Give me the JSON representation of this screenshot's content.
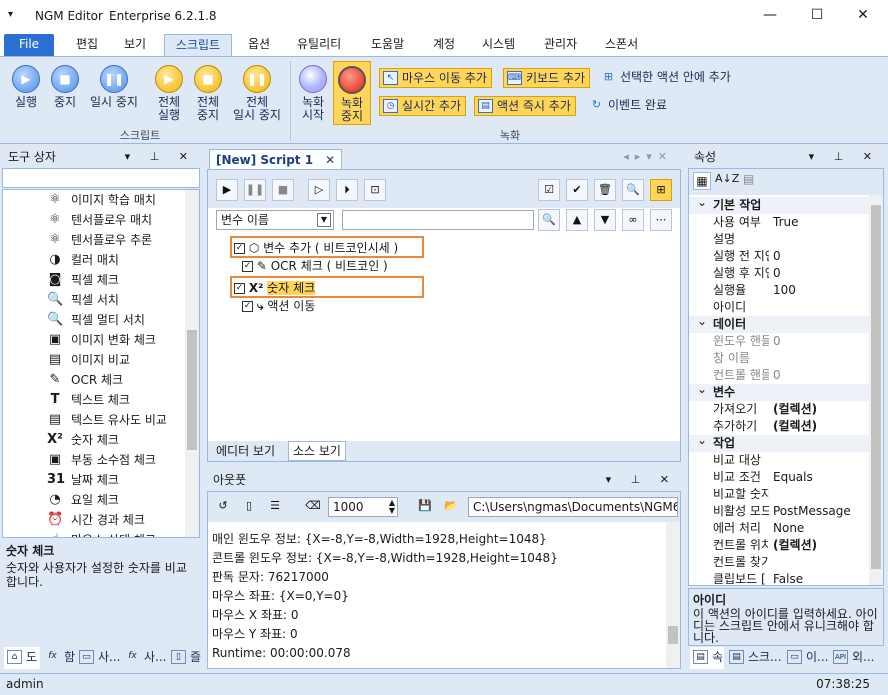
{
  "titlebar": {
    "app": "NGM Editor",
    "edition": "Enterprise 6.2.1.8",
    "menu_icon": "chevron-down-icon",
    "min": "—",
    "max": "☐",
    "close": "✕"
  },
  "menu": [
    "File",
    "편집",
    "보기",
    "스크립트",
    "옵션",
    "유틸리티",
    "도움말",
    "계정",
    "시스템",
    "관리자",
    "스폰서"
  ],
  "ribbon": {
    "script_buttons": [
      {
        "label": "실행",
        "glyph": "▶"
      },
      {
        "label": "중지",
        "glyph": "■"
      },
      {
        "label": "일시 중지",
        "glyph": "❚❚"
      },
      {
        "label": "전체\n실행",
        "glyph": "▶"
      },
      {
        "label": "전체\n중지",
        "glyph": "■"
      },
      {
        "label": "전체\n일시 중지",
        "glyph": "❚❚"
      }
    ],
    "script_group": "스크립트",
    "record_buttons": [
      {
        "label": "녹화\n시작"
      },
      {
        "label": "녹화\n중지"
      }
    ],
    "record_small": [
      "마우스 이동 추가",
      "키보드 추가",
      "선택한 액션 안에 추가",
      "실시간 추가",
      "액션 즉시 추가",
      "이벤트 완료"
    ],
    "record_group": "녹화"
  },
  "toolbox": {
    "title": "도구 상자",
    "items": [
      {
        "label": "이미지 학습 매치",
        "icon": "⚛"
      },
      {
        "label": "텐서플로우 매치",
        "icon": "⚛"
      },
      {
        "label": "텐서플로우 추론",
        "icon": "⚛"
      },
      {
        "label": "컬러 매치",
        "icon": "◑"
      },
      {
        "label": "픽셀 체크",
        "icon": "◙"
      },
      {
        "label": "픽셀 서치",
        "icon": "🔍"
      },
      {
        "label": "픽셀 멀티 서치",
        "icon": "🔍"
      },
      {
        "label": "이미지 변화 체크",
        "icon": "▣"
      },
      {
        "label": "이미지 비교",
        "icon": "▤"
      },
      {
        "label": "OCR 체크",
        "icon": "✎"
      },
      {
        "label": "텍스트 체크",
        "icon": "T"
      },
      {
        "label": "텍스트 유사도 비교",
        "icon": "▤"
      },
      {
        "label": "숫자 체크",
        "icon": "X²"
      },
      {
        "label": "부동 소수점 체크",
        "icon": "▣"
      },
      {
        "label": "날짜 체크",
        "icon": "31"
      },
      {
        "label": "요일 체크",
        "icon": "◔"
      },
      {
        "label": "시간 경과 체크",
        "icon": "⏰"
      },
      {
        "label": "마우스 상태 체크",
        "icon": "☝"
      }
    ],
    "desc_title": "숫자 체크",
    "desc_text": "숫자와 사용자가 설정한 숫자를 비교합니다.",
    "tabs": [
      "도",
      "함",
      "사...",
      "사...",
      "즐"
    ]
  },
  "editor": {
    "tab": "[New] Script 1",
    "var_combo": "변수 이름",
    "search_value": "",
    "tree": [
      {
        "label": "변수 추가 ( 비트코인시세 )",
        "icon": "⬡"
      },
      {
        "label": "OCR 체크 ( 비트코인 )",
        "icon": "✎"
      },
      {
        "label": "숫자 체크",
        "icon": "X²"
      },
      {
        "label": "액션 이동",
        "icon": "⤷"
      }
    ],
    "view_tabs": [
      "에디터 보기",
      "소스 보기"
    ]
  },
  "output": {
    "title": "아웃풋",
    "count": "1000",
    "path": "C:\\Users\\ngmas\\Documents\\NGM6\\",
    "lines": [
      "매인 윈도우 정보: {X=-8,Y=-8,Width=1928,Height=1048}",
      "콘트롤 윈도우 정보: {X=-8,Y=-8,Width=1928,Height=1048}",
      "판독 문자: 76217000",
      "마우스 좌표: {X=0,Y=0}",
      "마우스 X 좌표: 0",
      "마우스 Y 좌표: 0",
      "Runtime: 00:00:00.078"
    ]
  },
  "props": {
    "title": "속성",
    "rows": [
      {
        "cat": "기본 작업"
      },
      {
        "k": "사용 여부",
        "v": "True"
      },
      {
        "k": "설명",
        "v": ""
      },
      {
        "k": "실행 전 지연",
        "v": "0"
      },
      {
        "k": "실행 후 지연",
        "v": "0"
      },
      {
        "k": "실행율",
        "v": "100"
      },
      {
        "k": "아이디",
        "v": ""
      },
      {
        "cat": "데이터"
      },
      {
        "k": "윈도우 핸들",
        "v": "0",
        "grey": true
      },
      {
        "k": "창 이름",
        "v": "",
        "grey": true
      },
      {
        "k": "컨트롤 핸들",
        "v": "0",
        "grey": true
      },
      {
        "cat": "변수"
      },
      {
        "k": "가져오기",
        "v": "(컬렉션)",
        "bold": true
      },
      {
        "k": "추가하기",
        "v": "(컬렉션)",
        "bold": true
      },
      {
        "cat": "작업"
      },
      {
        "k": "비교 대상",
        "v": ""
      },
      {
        "k": "비교 조건",
        "v": "Equals"
      },
      {
        "k": "비교할 숫자",
        "v": ""
      },
      {
        "k": "비활성 모드",
        "v": "PostMessage"
      },
      {
        "k": "에러 처리",
        "v": "None"
      },
      {
        "k": "컨트롤 위치",
        "v": "(컬렉션)",
        "bold": true
      },
      {
        "k": "컨트롤 찾기",
        "v": ""
      },
      {
        "k": "클립보드 [",
        "v": "False"
      }
    ],
    "desc_title": "아이디",
    "desc_text": "이 액션의 아이디를 입력하세요. 아이디는 스크립트 안에서 유니크해야 합니다.",
    "tabs": [
      "속",
      "스크...",
      "이...",
      "외..."
    ]
  },
  "status": {
    "user": "admin",
    "time": "07:38:25"
  }
}
